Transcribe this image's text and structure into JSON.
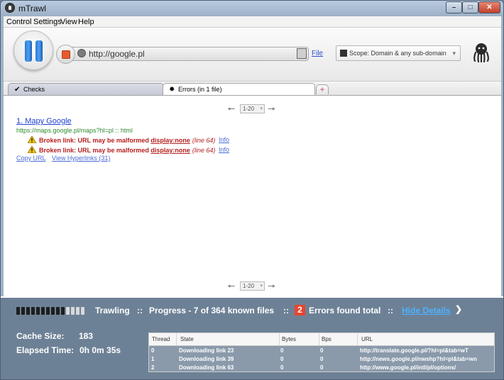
{
  "window": {
    "title": "mTrawl"
  },
  "menu": [
    "Control",
    "Settings",
    "View",
    "Help"
  ],
  "toolbar": {
    "url": "http://google.pl",
    "file_label": "File",
    "scope_label": "Scope: Domain & any sub-domain"
  },
  "tabs": [
    {
      "label": "Checks",
      "icon": "checkmark-icon",
      "active": false
    },
    {
      "label": "Errors (in 1 file)",
      "icon": "bug-icon",
      "active": true
    }
  ],
  "pager": {
    "range": "1-20"
  },
  "result": {
    "title": "1. Mapy Google",
    "url": "https://maps.google.pl/maps?hl=pl :: html",
    "errors": [
      {
        "message": "Broken link: URL may be malformed",
        "code": "display:none",
        "line": "(line 64)",
        "info": "Info"
      },
      {
        "message": "Broken link: URL may be malformed",
        "code": "display:none",
        "line": "(line 64)",
        "info": "Info"
      }
    ],
    "copy_url": "Copy URL",
    "view_links": "View Hyperlinks (31)"
  },
  "status": {
    "trawling": "Trawling",
    "sep1": "::",
    "progress": "Progress - 7 of 364 known files",
    "sep2": "::",
    "errors_count": "2",
    "errors_label": "Errors found total",
    "sep3": "::",
    "hide_details": "Hide Details",
    "progress_fraction": 0.7,
    "cache_label": "Cache Size:",
    "cache_value": "183",
    "elapsed_label": "Elapsed Time:",
    "elapsed_value": "0h 0m 35s"
  },
  "threads": {
    "headers": [
      "Thread",
      "State",
      "Bytes",
      "Bps",
      "URL"
    ],
    "rows": [
      [
        "0",
        "Downloading link 23",
        "0",
        "0",
        "http://translate.google.pl/?hl=pl&tab=wT"
      ],
      [
        "1",
        "Downloading link 39",
        "0",
        "0",
        "http://news.google.pl/nwshp?hl=pl&tab=wn"
      ],
      [
        "2",
        "Downloading link 63",
        "0",
        "0",
        "http://www.google.pl/intl/pl/options/"
      ]
    ]
  },
  "colors": {
    "accent": "#2a78d4",
    "status_bg": "#6d8196",
    "error": "#b61f1f",
    "badge": "#e8452f"
  }
}
